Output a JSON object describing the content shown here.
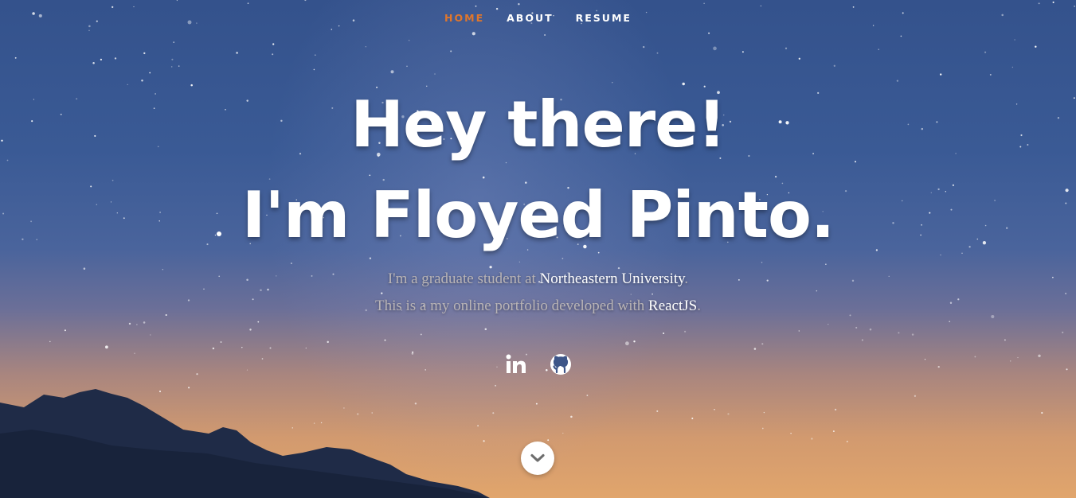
{
  "nav": {
    "items": [
      {
        "label": "HOME",
        "active": true
      },
      {
        "label": "ABOUT",
        "active": false
      },
      {
        "label": "RESUME",
        "active": false
      }
    ]
  },
  "hero": {
    "line1": "Hey there!",
    "line2": "I'm Floyed Pinto.",
    "sub1_prefix": "I'm a graduate student at ",
    "sub1_highlight": "Northeastern University",
    "sub1_suffix": ".",
    "sub2_prefix": "This is a my online portfolio developed with ",
    "sub2_highlight": "ReactJS",
    "sub2_suffix": "."
  },
  "social": {
    "items": [
      {
        "icon": "linkedin-icon"
      },
      {
        "icon": "github-icon"
      }
    ]
  },
  "scroll": {
    "icon": "chevron-down-icon"
  },
  "colors": {
    "accent": "#e0762b",
    "text": "#ffffff",
    "muted_text": "#b9b4b6"
  }
}
